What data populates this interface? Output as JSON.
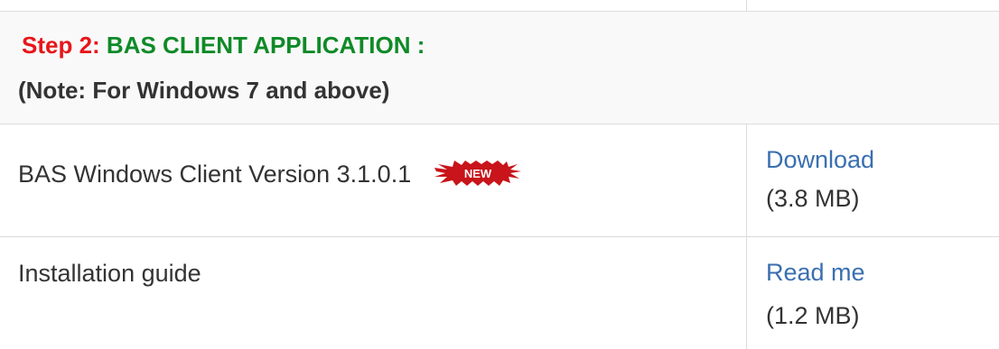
{
  "section": {
    "step_label": "Step 2:",
    "step_title": "BAS CLIENT APPLICATION :",
    "note": "(Note: For Windows 7 and above)"
  },
  "items": [
    {
      "name": "BAS Windows Client Version 3.1.0.1",
      "badge": "NEW",
      "badge_icon": "new-starburst-icon",
      "link_label": "Download",
      "size": "(3.8 MB)"
    },
    {
      "name": "Installation guide",
      "link_label": "Read me",
      "size": "(1.2 MB)"
    }
  ],
  "colors": {
    "step_label": "#e6161b",
    "step_title": "#0f8a28",
    "link": "#3a6fb0",
    "text": "#333333",
    "border": "#dcdcdc",
    "badge_fill": "#c8141a"
  }
}
